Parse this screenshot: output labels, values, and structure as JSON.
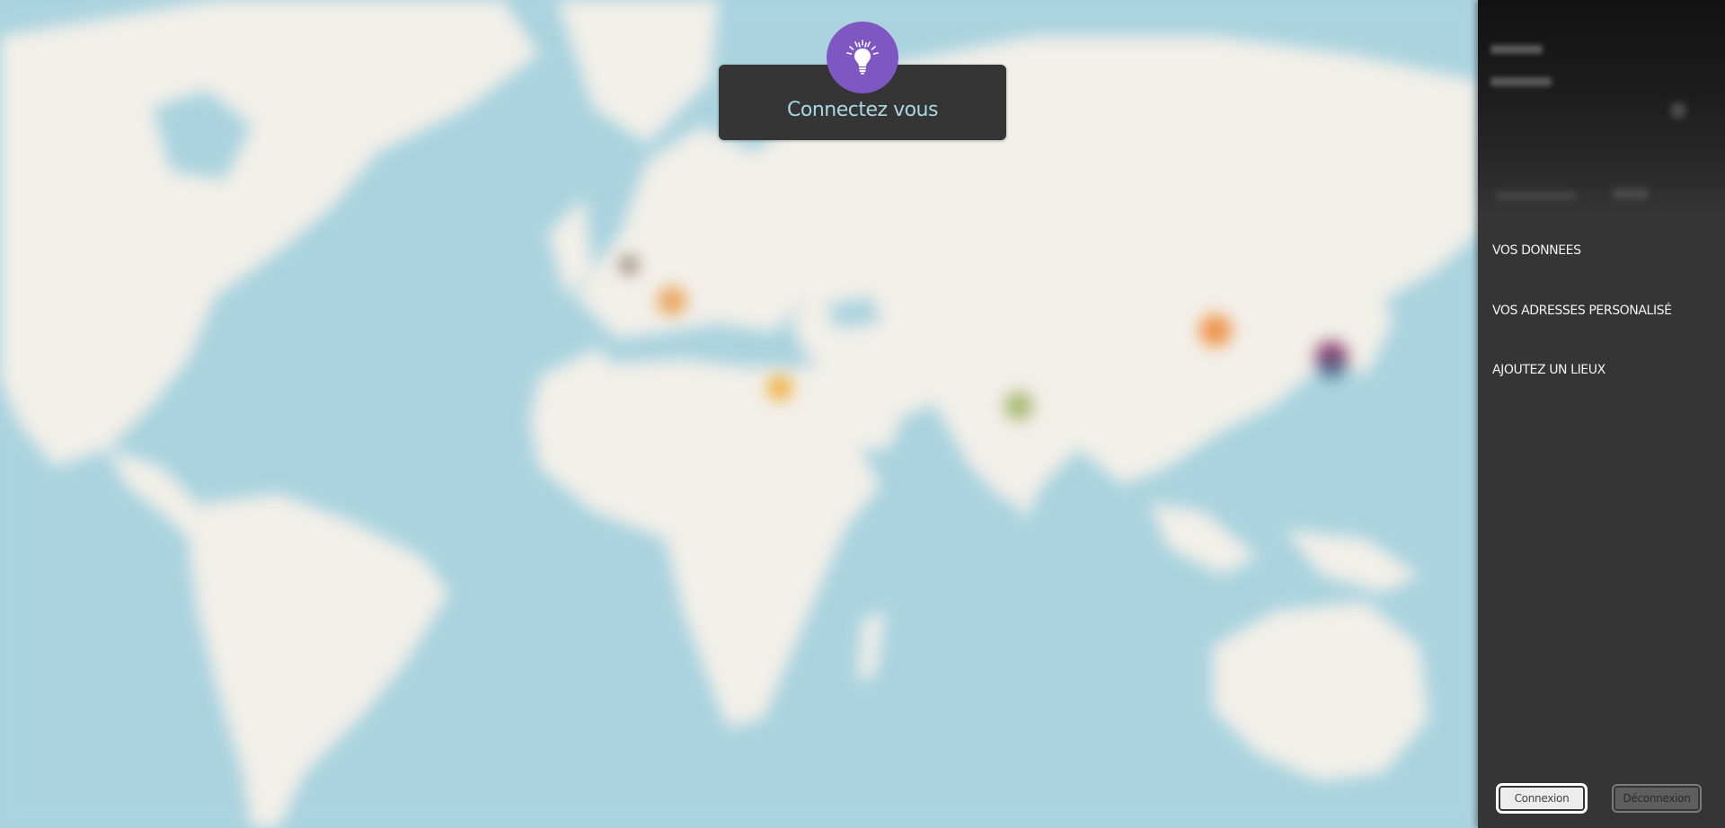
{
  "notification": {
    "text": "Connectez vous",
    "icon": "lightbulb-icon",
    "icon_bg_color": "#7e57c2",
    "text_color": "#a9d8e3"
  },
  "sidebar": {
    "menu": [
      {
        "label": "VOS DONNEES"
      },
      {
        "label": "VOS ADRESSES PERSONALISÉ"
      },
      {
        "label": "AJOUTEZ UN LIEUX"
      }
    ],
    "buttons": {
      "connexion": "Connexion",
      "deconnexion": "Déconnexion"
    }
  },
  "colors": {
    "ocean": "#aad3df",
    "land": "#f2efe9",
    "panel": "#353535",
    "accent": "#7e57c2"
  }
}
